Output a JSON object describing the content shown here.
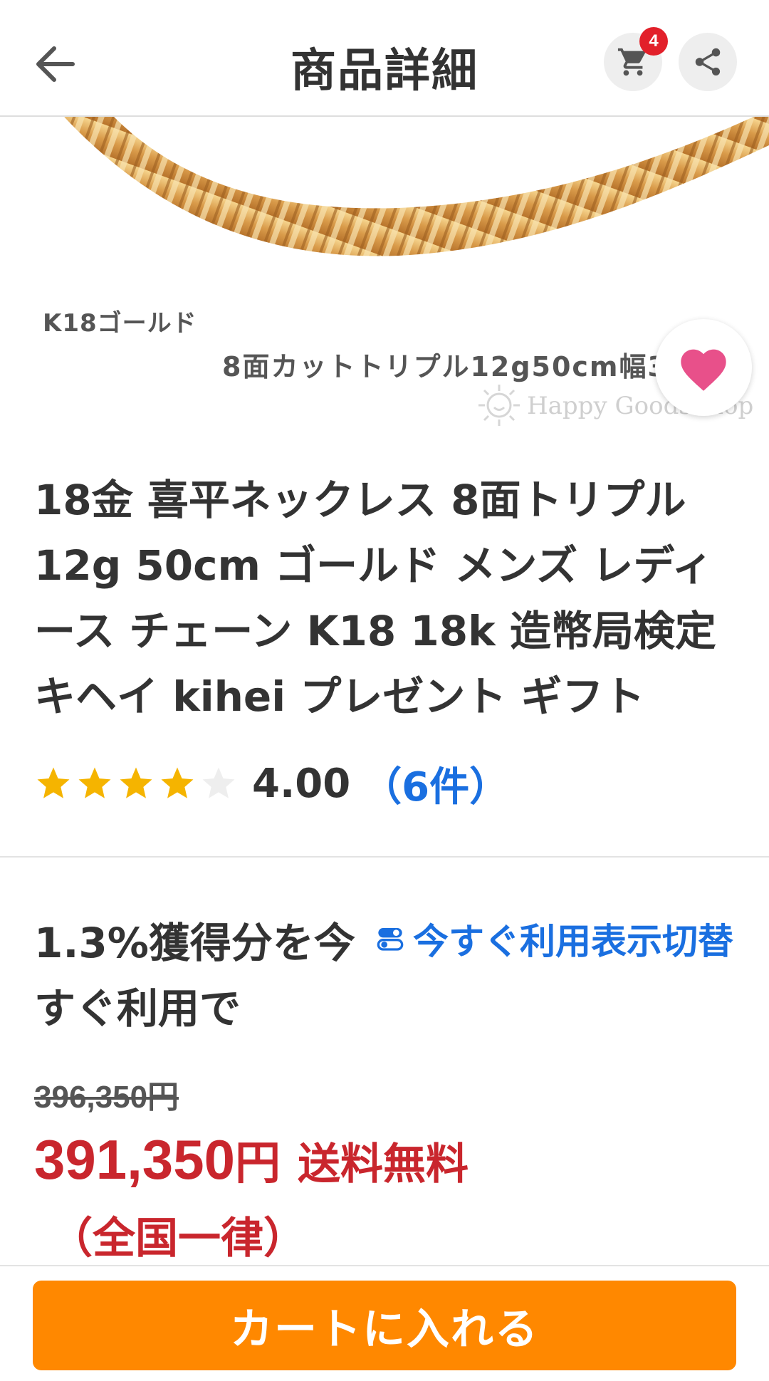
{
  "header": {
    "title": "商品詳細",
    "cart_badge": "4"
  },
  "image": {
    "caption_material": "K18ゴールド",
    "caption_spec": "8面カットトリプル12g50cm幅3",
    "watermark": "Happy GoodsShop"
  },
  "product": {
    "title": "18金 喜平ネックレス 8面トリプル 12g 50cm ゴールド メンズ レディース チェーン K18 18k 造幣局検定 キヘイ kihei プレゼント ギフト",
    "rating": {
      "stars_filled": 4,
      "stars_total": 5,
      "score": "4.00",
      "count_label": "（6件）"
    }
  },
  "points": {
    "text": "1.3%獲得分を今すぐ利用で",
    "toggle_label": "今すぐ利用表示切替"
  },
  "pricing": {
    "original_price": "396,350円",
    "price": "391,350",
    "currency": "円",
    "shipping": "送料無料",
    "shipping_note": "（全国一律）"
  },
  "actions": {
    "add_to_cart": "カートに入れる"
  },
  "colors": {
    "accent_orange": "#ff8800",
    "price_red": "#c9262d",
    "link_blue": "#1a6fe0",
    "star_gold": "#f5b400",
    "heart_pink": "#e8508a"
  }
}
